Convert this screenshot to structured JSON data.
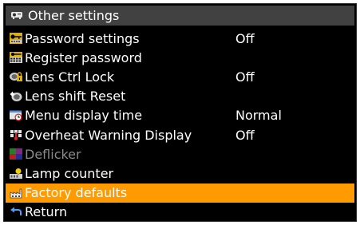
{
  "header": {
    "title": "Other settings",
    "icon": "projector-icon"
  },
  "items": [
    {
      "label": "Password settings",
      "value": "Off",
      "icon": "key-icon",
      "state": "normal"
    },
    {
      "label": "Register password",
      "value": "",
      "icon": "key-keypad-icon",
      "state": "normal"
    },
    {
      "label": "Lens Ctrl Lock",
      "value": "Off",
      "icon": "lens-lock-icon",
      "state": "normal"
    },
    {
      "label": "Lens shift Reset",
      "value": "",
      "icon": "lens-shift-icon",
      "state": "normal"
    },
    {
      "label": "Menu display time",
      "value": "Normal",
      "icon": "clock-icon",
      "state": "normal"
    },
    {
      "label": "Overheat Warning Display",
      "value": "Off",
      "icon": "thermometer-icon",
      "state": "normal"
    },
    {
      "label": "Deflicker",
      "value": "",
      "icon": "color-blocks-icon",
      "state": "disabled"
    },
    {
      "label": "Lamp counter",
      "value": "",
      "icon": "lamp-icon",
      "state": "normal"
    },
    {
      "label": "Factory defaults",
      "value": "",
      "icon": "factory-icon",
      "state": "selected"
    },
    {
      "label": "Return",
      "value": "",
      "icon": "return-arrow-icon",
      "state": "normal"
    }
  ],
  "colors": {
    "background": "#000000",
    "header": "#414141",
    "selected": "#ff9a00",
    "text": "#ffffff",
    "disabled": "#8a8a8a"
  }
}
